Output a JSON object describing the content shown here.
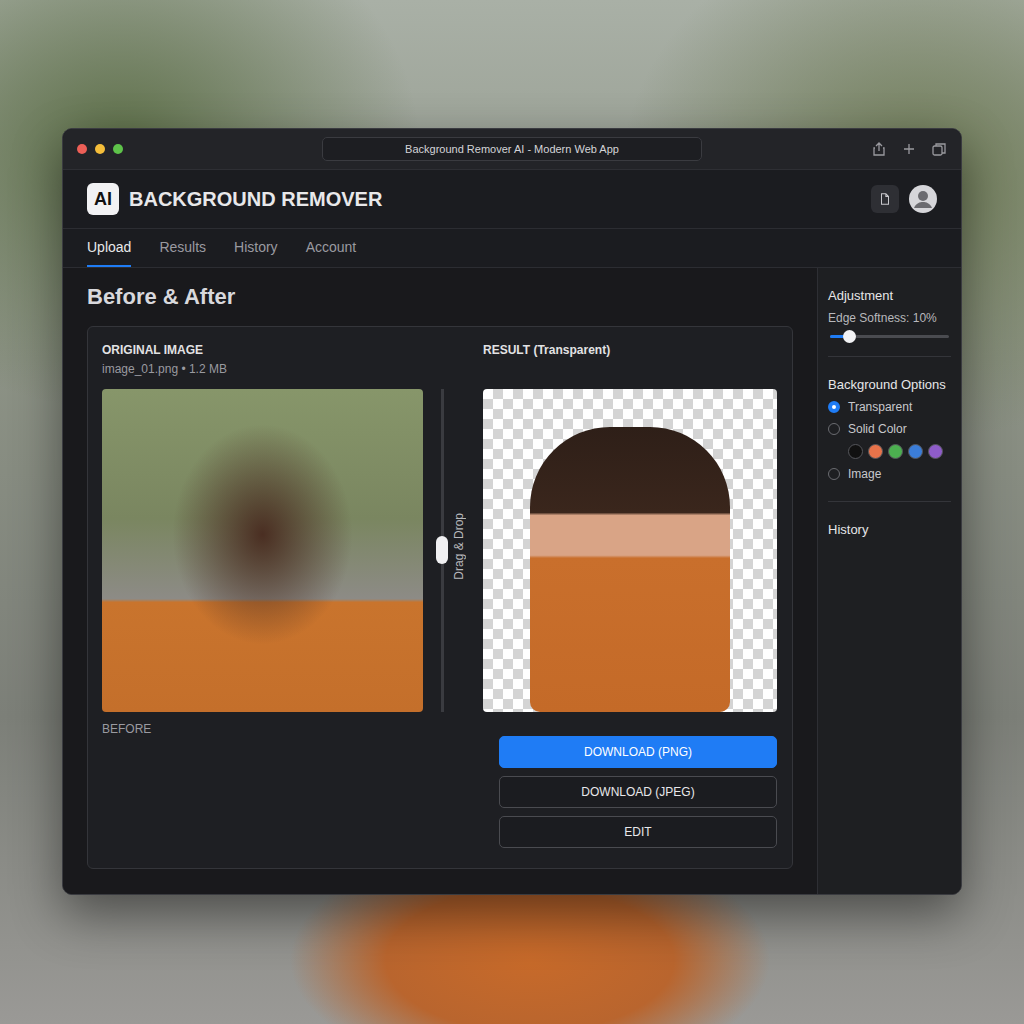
{
  "window": {
    "title": "Background Remover AI - Modern Web App"
  },
  "app": {
    "logo": "AI",
    "name": "BACKGROUND REMOVER"
  },
  "tabs": [
    {
      "label": "Upload",
      "selected": true
    },
    {
      "label": "Results",
      "selected": false
    },
    {
      "label": "History",
      "selected": false
    },
    {
      "label": "Account",
      "selected": false
    }
  ],
  "heading": "Before & After",
  "original": {
    "label": "ORIGINAL IMAGE",
    "file": "image_01.png • 1.2 MB",
    "caption": "BEFORE"
  },
  "divider": {
    "label": "Drag & Drop"
  },
  "result": {
    "label": "RESULT (Transparent)"
  },
  "buttons": [
    {
      "label": "DOWNLOAD (PNG)",
      "primary": true
    },
    {
      "label": "DOWNLOAD (JPEG)",
      "primary": false
    },
    {
      "label": "EDIT",
      "primary": false
    }
  ],
  "sidebar": {
    "adjustment": {
      "title": "Adjustment",
      "label": "Edge Softness: 10%",
      "level": 0.16
    },
    "background_options": {
      "title": "Background Options",
      "options": [
        {
          "label": "Transparent",
          "selected": true,
          "kind": "plain"
        },
        {
          "label": "Solid Color",
          "selected": false,
          "kind": "swatches",
          "swatches": [
            {
              "color": "#111111"
            },
            {
              "color": "#e8734a"
            },
            {
              "color": "#4caf50"
            },
            {
              "color": "#3b7dd8"
            },
            {
              "color": "#8e5cc9"
            }
          ]
        },
        {
          "label": "Image",
          "selected": false,
          "kind": "plain"
        }
      ]
    },
    "history": {
      "title": "History"
    }
  }
}
